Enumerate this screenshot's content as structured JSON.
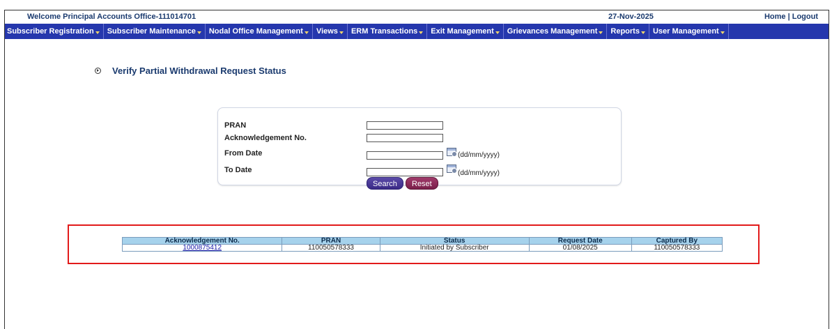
{
  "topbar": {
    "welcome": "Welcome Principal Accounts Office-111014701",
    "date": "27-Nov-2025",
    "home": "Home",
    "separator": " | ",
    "logout": "Logout"
  },
  "menu": [
    {
      "label": "Subscriber Registration"
    },
    {
      "label": "Subscriber Maintenance"
    },
    {
      "label": "Nodal Office Management"
    },
    {
      "label": "Views"
    },
    {
      "label": "ERM Transactions"
    },
    {
      "label": "Exit Management"
    },
    {
      "label": "Grievances Management"
    },
    {
      "label": "Reports"
    },
    {
      "label": "User Management"
    }
  ],
  "page": {
    "title": "Verify Partial Withdrawal Request Status"
  },
  "form": {
    "pran_label": "PRAN",
    "ack_label": "Acknowledgement No.",
    "from_label": "From Date",
    "to_label": "To Date",
    "date_format": "(dd/mm/yyyy)",
    "pran_value": "",
    "ack_value": "",
    "from_value": "",
    "to_value": "",
    "search_label": "Search",
    "reset_label": "Reset"
  },
  "results": {
    "headers": [
      "Acknowledgement No.",
      "PRAN",
      "Status",
      "Request Date",
      "Captured By"
    ],
    "rows": [
      [
        "1000875412",
        "110050578333",
        "Initiated by Subscriber",
        "01/08/2025",
        "110050578333"
      ]
    ]
  },
  "colors": {
    "menubar": "#2537ad",
    "title": "#1a3a6e",
    "highlight_border": "#e21a1a",
    "table_header": "#a6d2ec"
  }
}
